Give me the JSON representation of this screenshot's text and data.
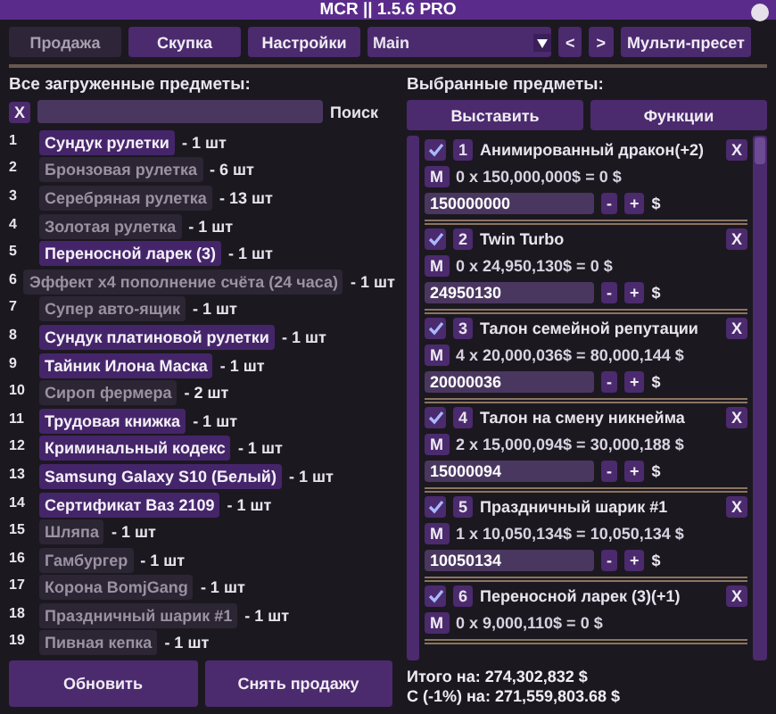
{
  "window": {
    "title": "MCR || 1.5.6 PRO"
  },
  "tabs": [
    {
      "label": "Продажа",
      "selected": true
    },
    {
      "label": "Скупка",
      "selected": false
    },
    {
      "label": "Настройки",
      "selected": false
    }
  ],
  "preset": {
    "value": "Main",
    "prev": "<",
    "next": ">",
    "multi": "Мульти-пресет"
  },
  "left": {
    "heading": "Все загруженные предметы:",
    "clear": "X",
    "search_label": "Поиск",
    "items": [
      {
        "num": "1",
        "name": "Сундук рулетки",
        "count": "- 1 шт",
        "selected": true
      },
      {
        "num": "2",
        "name": "Бронзовая рулетка",
        "count": "- 6 шт",
        "selected": false
      },
      {
        "num": "3",
        "name": "Серебряная рулетка",
        "count": "- 13 шт",
        "selected": false
      },
      {
        "num": "4",
        "name": "Золотая рулетка",
        "count": "- 1 шт",
        "selected": false
      },
      {
        "num": "5",
        "name": "Переносной ларек (3)",
        "count": "- 1 шт",
        "selected": true
      },
      {
        "num": "6",
        "name": "Эффект x4 пополнение счёта (24 часа)",
        "count": "- 1 шт",
        "selected": false
      },
      {
        "num": "7",
        "name": "Супер авто-ящик",
        "count": "- 1 шт",
        "selected": false
      },
      {
        "num": "8",
        "name": "Сундук платиновой рулетки",
        "count": "- 1 шт",
        "selected": true
      },
      {
        "num": "9",
        "name": "Тайник Илона Маска",
        "count": "- 1 шт",
        "selected": true
      },
      {
        "num": "10",
        "name": "Сироп фермера",
        "count": "- 2 шт",
        "selected": false
      },
      {
        "num": "11",
        "name": "Трудовая книжка",
        "count": "- 1 шт",
        "selected": true
      },
      {
        "num": "12",
        "name": "Криминальный кодекс",
        "count": "- 1 шт",
        "selected": true
      },
      {
        "num": "13",
        "name": "Samsung Galaxy S10 (Белый)",
        "count": "- 1 шт",
        "selected": true
      },
      {
        "num": "14",
        "name": "Сертификат Ваз 2109",
        "count": "- 1 шт",
        "selected": true
      },
      {
        "num": "15",
        "name": "Шляпа",
        "count": "- 1 шт",
        "selected": false
      },
      {
        "num": "16",
        "name": "Гамбургер",
        "count": "- 1 шт",
        "selected": false
      },
      {
        "num": "17",
        "name": "Корона BomjGang",
        "count": "- 1 шт",
        "selected": false
      },
      {
        "num": "18",
        "name": "Праздничный шарик #1",
        "count": "- 1 шт",
        "selected": false
      },
      {
        "num": "19",
        "name": "Пивная кепка",
        "count": "- 1 шт",
        "selected": false
      }
    ],
    "buttons": [
      "Обновить",
      "Снять продажу"
    ]
  },
  "right": {
    "heading": "Выбранные предметы:",
    "buttons": [
      "Выставить",
      "Функции"
    ],
    "lots": [
      {
        "checked": true,
        "num": "1",
        "name": "Анимированный дракон(+2)",
        "remove": "X",
        "mode": "M",
        "formula": "0 x 150,000,000$ = 0 $",
        "value": "150000000",
        "minus": "-",
        "plus": "+",
        "currency": "$"
      },
      {
        "checked": true,
        "num": "2",
        "name": "Twin Turbo",
        "remove": "X",
        "mode": "M",
        "formula": "0 x 24,950,130$ = 0 $",
        "value": "24950130",
        "minus": "-",
        "plus": "+",
        "currency": "$"
      },
      {
        "checked": true,
        "num": "3",
        "name": "Талон семейной репутации",
        "remove": "X",
        "mode": "M",
        "formula": "4 x 20,000,036$ = 80,000,144 $",
        "value": "20000036",
        "minus": "-",
        "plus": "+",
        "currency": "$"
      },
      {
        "checked": true,
        "num": "4",
        "name": "Талон на смену никнейма",
        "remove": "X",
        "mode": "M",
        "formula": "2 x 15,000,094$ = 30,000,188 $",
        "value": "15000094",
        "minus": "-",
        "plus": "+",
        "currency": "$"
      },
      {
        "checked": true,
        "num": "5",
        "name": "Праздничный шарик #1",
        "remove": "X",
        "mode": "M",
        "formula": "1 x 10,050,134$ = 10,050,134 $",
        "value": "10050134",
        "minus": "-",
        "plus": "+",
        "currency": "$"
      },
      {
        "checked": true,
        "num": "6",
        "name": "Переносной ларек (3)(+1)",
        "remove": "X",
        "mode": "M",
        "formula": "0 x 9,000,110$ = 0 $"
      }
    ],
    "totals": [
      "Итого на: 274,302,832 $",
      "С (-1%) на: 271,559,803.68 $"
    ]
  }
}
